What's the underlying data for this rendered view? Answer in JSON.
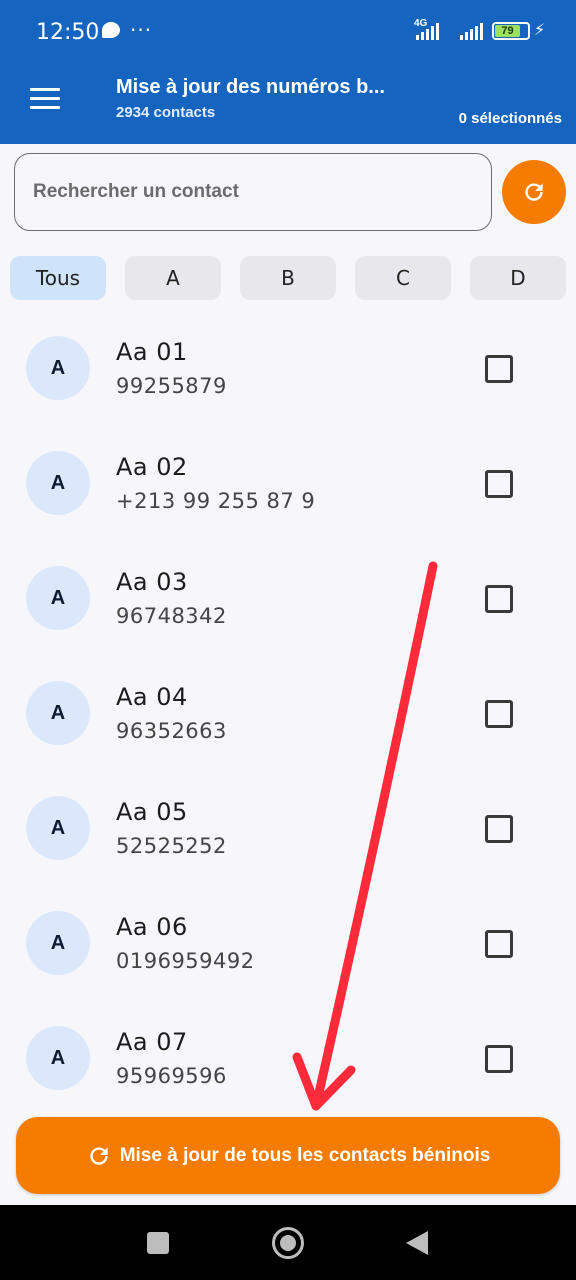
{
  "status_bar": {
    "time": "12:50",
    "dots": "···",
    "network_label": "4G",
    "battery": "79",
    "battery_fraction": 0.79
  },
  "app_bar": {
    "title": "Mise à jour des numéros b...",
    "subtitle": "2934 contacts",
    "selected": "0 sélectionnés"
  },
  "search": {
    "placeholder": "Rechercher un contact",
    "value": ""
  },
  "filters": [
    "Tous",
    "A",
    "B",
    "C",
    "D"
  ],
  "active_filter": "Tous",
  "contacts": [
    {
      "initial": "A",
      "name": "Aa 01",
      "phone": "99255879"
    },
    {
      "initial": "A",
      "name": "Aa 02",
      "phone": "+213 99 255 87 9"
    },
    {
      "initial": "A",
      "name": "Aa 03",
      "phone": "96748342"
    },
    {
      "initial": "A",
      "name": "Aa 04",
      "phone": "96352663"
    },
    {
      "initial": "A",
      "name": "Aa 05",
      "phone": "52525252"
    },
    {
      "initial": "A",
      "name": "Aa 06",
      "phone": "0196959492"
    },
    {
      "initial": "A",
      "name": "Aa 07",
      "phone": "95969596"
    }
  ],
  "update_button": {
    "label": "Mise à jour de tous les contacts béninois"
  },
  "colors": {
    "primary": "#1565c0",
    "accent": "#f57c00",
    "annotation": "#ff2b3b"
  }
}
